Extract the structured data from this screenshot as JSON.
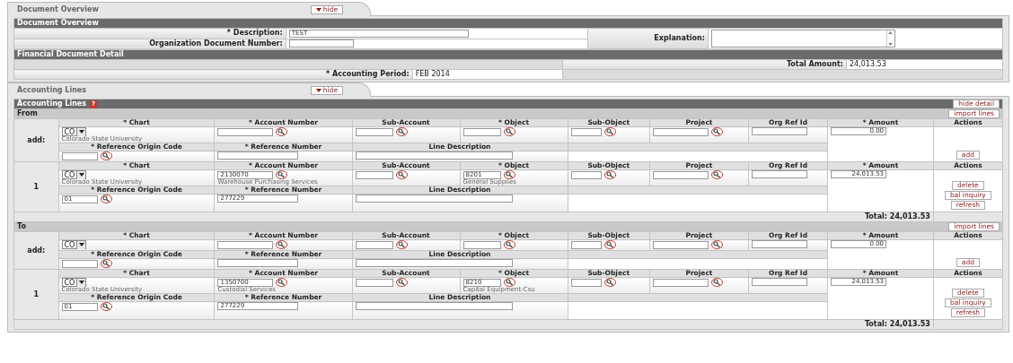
{
  "document_overview_tab": {
    "title": "Document Overview",
    "toggle": "hide"
  },
  "document_overview": {
    "header": "Document Overview",
    "fields": [
      {
        "label": "* Description:",
        "value": "TEST"
      },
      {
        "label": "Organization Document Number:"
      }
    ],
    "explanation": {
      "label": "Explanation:"
    }
  },
  "financial_document_detail": {
    "header": "Financial Document Detail",
    "total_amount": {
      "label": "Total Amount:",
      "value": "24,013.53"
    },
    "accounting_period": {
      "label": "* Accounting Period:",
      "value": "FEB 2014"
    }
  },
  "accounting_lines_tab": {
    "title": "Accounting Lines",
    "toggle": "hide"
  },
  "accounting_lines": {
    "header": "Accounting Lines",
    "help": "?",
    "hide_detail": "hide detail",
    "sections": [
      {
        "title": "From",
        "import_button": "import lines",
        "total": "Total: 24,013.53",
        "rows": [
          {
            "label": "add:",
            "headings_top": [
              "* Chart",
              "* Account Number",
              "Sub-Account",
              "* Object",
              "Sub-Object",
              "Project",
              "Org Ref Id",
              "* Amount",
              "Actions"
            ],
            "headings_bottom": [
              "* Reference Origin Code",
              "* Reference Number",
              "Line Description"
            ],
            "chart": "CO",
            "chart_name": "Colorado State University",
            "amount": "0.00",
            "actions": [
              "add"
            ]
          },
          {
            "label": "1",
            "headings_top": [
              "* Chart",
              "* Account Number",
              "Sub-Account",
              "* Object",
              "Sub-Object",
              "Project",
              "Org Ref Id",
              "* Amount",
              "Actions"
            ],
            "headings_bottom": [
              "* Reference Origin Code",
              "* Reference Number",
              "Line Description"
            ],
            "chart": "CO",
            "chart_name": "Colorado State University",
            "account_number": "2130070",
            "account_name": "Warehouse Purchasing Services",
            "object": "8201",
            "object_name": "General Supplies",
            "reference_origin_code": "01",
            "reference_number": "277229",
            "amount": "24,013.53",
            "actions": [
              "delete",
              "bal inquiry",
              "refresh"
            ]
          }
        ]
      },
      {
        "title": "To",
        "import_button": "import lines",
        "total": "Total: 24,013.53",
        "rows": [
          {
            "label": "add:",
            "headings_top": [
              "* Chart",
              "* Account Number",
              "Sub-Account",
              "* Object",
              "Sub-Object",
              "Project",
              "Org Ref Id",
              "* Amount",
              "Actions"
            ],
            "headings_bottom": [
              "* Reference Origin Code",
              "* Reference Number",
              "Line Description"
            ],
            "chart": "CO",
            "amount": "0.00",
            "actions": [
              "add"
            ]
          },
          {
            "label": "1",
            "headings_top": [
              "* Chart",
              "* Account Number",
              "Sub-Account",
              "* Object",
              "Sub-Object",
              "Project",
              "Org Ref Id",
              "* Amount",
              "Actions"
            ],
            "headings_bottom": [
              "* Reference Origin Code",
              "* Reference Number",
              "Line Description"
            ],
            "chart": "CO",
            "chart_name": "Colorado State University",
            "account_number": "1350700",
            "account_name": "Custodial Services",
            "object": "8210",
            "object_name": "Capital Equipment-Csu",
            "reference_origin_code": "01",
            "reference_number": "277229",
            "amount": "24,013.53",
            "actions": [
              "delete",
              "bal inquiry",
              "refresh"
            ]
          }
        ]
      }
    ]
  }
}
